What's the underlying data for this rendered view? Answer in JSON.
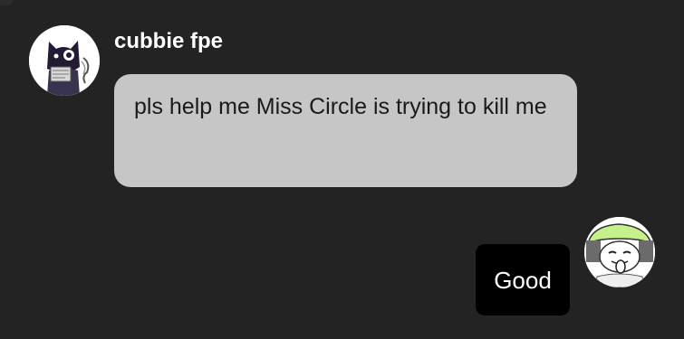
{
  "chat": {
    "background_color": "#232323",
    "messages": [
      {
        "sender": "cubbie fpe",
        "avatar_icon": "black-cat-character-avatar-icon",
        "text": "pls help me Miss Circle is trying to kill me",
        "bubble_color": "#c6c6c6",
        "text_color": "#1a1a1a"
      },
      {
        "avatar_icon": "cartoon-face-green-hat-avatar-icon",
        "text": "Good",
        "bubble_color": "#000000",
        "text_color": "#ffffff"
      }
    ]
  }
}
